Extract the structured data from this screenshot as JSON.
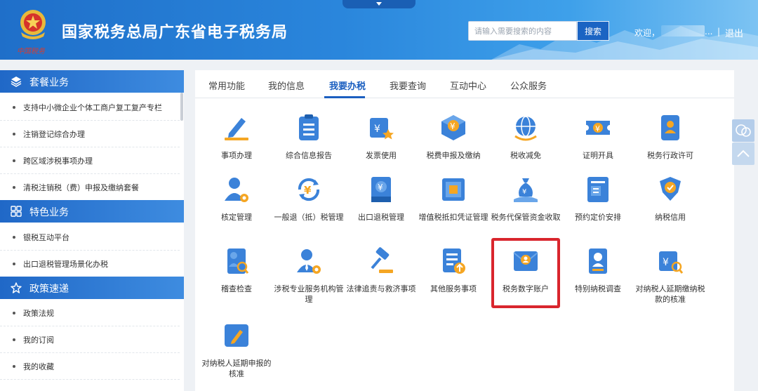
{
  "header": {
    "site_title": "国家税务总局广东省电子税务局",
    "emblem_caption": "中国税务",
    "search_placeholder": "请输入需要搜索的内容",
    "search_button": "搜索",
    "welcome_label": "欢迎，",
    "username_ellipsis": "...",
    "separator": "|",
    "logout": "退出"
  },
  "sidebar": {
    "sections": [
      {
        "title": "套餐业务",
        "icon": "layers-icon",
        "items": [
          "支持中小微企业个体工商户复工复产专栏",
          "注销登记综合办理",
          "跨区域涉税事项办理",
          "清税注销税（费）申报及缴纳套餐"
        ]
      },
      {
        "title": "特色业务",
        "icon": "grid-icon",
        "items": [
          "银税互动平台",
          "出口退税管理场景化办税"
        ]
      },
      {
        "title": "政策速递",
        "icon": "star-icon",
        "items": [
          "政策法规",
          "我的订阅",
          "我的收藏"
        ]
      }
    ]
  },
  "tabs": [
    "常用功能",
    "我的信息",
    "我要办税",
    "我要查询",
    "互动中心",
    "公众服务"
  ],
  "active_tab": "我要办税",
  "functions": [
    {
      "label": "事项办理",
      "icon": "pen-icon"
    },
    {
      "label": "综合信息报告",
      "icon": "clipboard-icon"
    },
    {
      "label": "发票使用",
      "icon": "invoice-icon"
    },
    {
      "label": "税费申报及缴纳",
      "icon": "yuan-box-icon"
    },
    {
      "label": "税收减免",
      "icon": "globe-icon"
    },
    {
      "label": "证明开具",
      "icon": "ticket-icon"
    },
    {
      "label": "税务行政许可",
      "icon": "badge-icon"
    },
    {
      "label": "核定管理",
      "icon": "user-gear-icon"
    },
    {
      "label": "一般退（抵）税管理",
      "icon": "refresh-yuan-icon"
    },
    {
      "label": "出口退税管理",
      "icon": "book-yuan-icon"
    },
    {
      "label": "增值税抵扣凭证管理",
      "icon": "voucher-icon"
    },
    {
      "label": "税务代保管资金收取",
      "icon": "money-bag-icon"
    },
    {
      "label": "预约定价安排",
      "icon": "document-icon"
    },
    {
      "label": "纳税信用",
      "icon": "shield-check-icon"
    },
    {
      "label": "稽查检查",
      "icon": "inspect-icon"
    },
    {
      "label": "涉税专业服务机构管理",
      "icon": "agent-gear-icon"
    },
    {
      "label": "法律追责与救济事项",
      "icon": "gavel-icon"
    },
    {
      "label": "其他服务事项",
      "icon": "list-upload-icon"
    },
    {
      "label": "税务数字账户",
      "icon": "digital-account-icon"
    },
    {
      "label": "特别纳税调查",
      "icon": "id-card-icon"
    },
    {
      "label": "对纳税人延期缴纳税款的核准",
      "icon": "yuan-search-icon"
    },
    {
      "label": "对纳税人延期申报的核准",
      "icon": "pen-box-icon"
    }
  ],
  "highlighted_function": "税务数字账户",
  "colors": {
    "accent": "#1b5fc0",
    "icon_blue": "#3b82d9",
    "icon_orange": "#f5a623",
    "highlight_red": "#d9262d"
  }
}
